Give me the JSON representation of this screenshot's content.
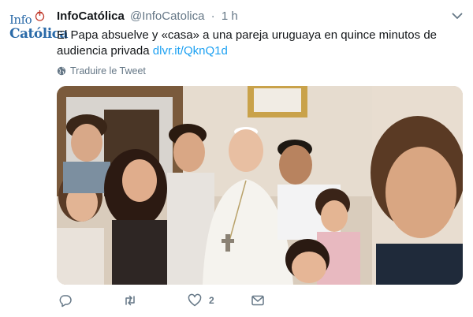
{
  "account": {
    "avatar_line1": "Info",
    "avatar_line2": "Católica",
    "display_name": "InfoCatólica",
    "handle": "@InfoCatolica",
    "separator": "·",
    "time": "1 h"
  },
  "tweet": {
    "text": "El Papa absuelve y «casa» a una pareja uruguaya en quince minutos de audiencia privada",
    "link": "dlvr.it/QknQ1d",
    "translate_label": "Traduire le Tweet"
  },
  "media": {
    "description_icon": "photo"
  },
  "actions": {
    "reply_icon": "reply-icon",
    "retweet_icon": "retweet-icon",
    "like_icon": "heart-icon",
    "like_count": "2",
    "dm_icon": "envelope-icon"
  },
  "colors": {
    "link": "#1da1f2",
    "secondary_text": "#657786",
    "avatar_brand": "#2a6aa8"
  }
}
